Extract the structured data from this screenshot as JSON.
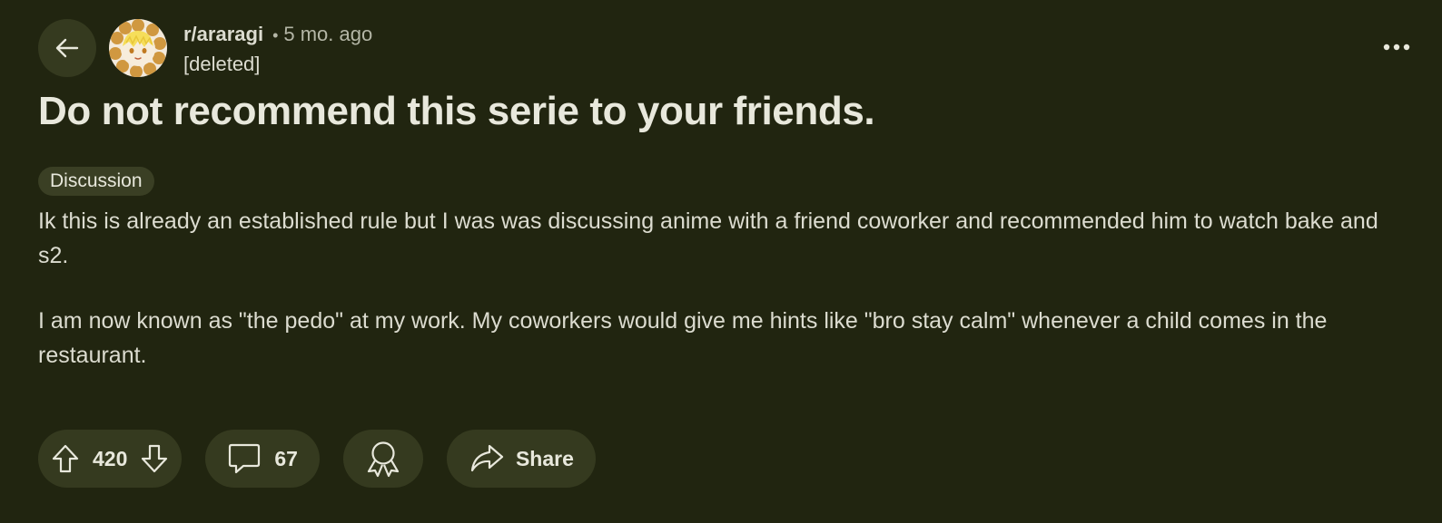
{
  "header": {
    "subreddit": "r/araragi",
    "separator": "•",
    "time_ago": "5 mo. ago",
    "author": "[deleted]"
  },
  "post": {
    "title": "Do not recommend this serie to your friends.",
    "flair": "Discussion",
    "paragraphs": [
      "Ik this is already an established rule but I was was discussing anime with a friend coworker and recommended him to watch bake and s2.",
      "I am now known as \"the pedo\" at my work. My coworkers would give me hints like \"bro stay calm\" whenever a child comes in the restaurant."
    ]
  },
  "actions": {
    "vote_count": "420",
    "comment_count": "67",
    "share_label": "Share"
  },
  "icons": {
    "back": "arrow-left-icon",
    "more": "more-horizontal-icon",
    "upvote": "upvote-arrow-icon",
    "downvote": "downvote-arrow-icon",
    "comment": "comment-bubble-icon",
    "award": "award-ribbon-icon",
    "share": "share-arrow-icon"
  },
  "colors": {
    "background": "#212510",
    "pill_background": "#353a1f",
    "flair_background": "#3a3f24",
    "text_primary": "#e8e8dc",
    "text_secondary": "#b4b6a6"
  }
}
